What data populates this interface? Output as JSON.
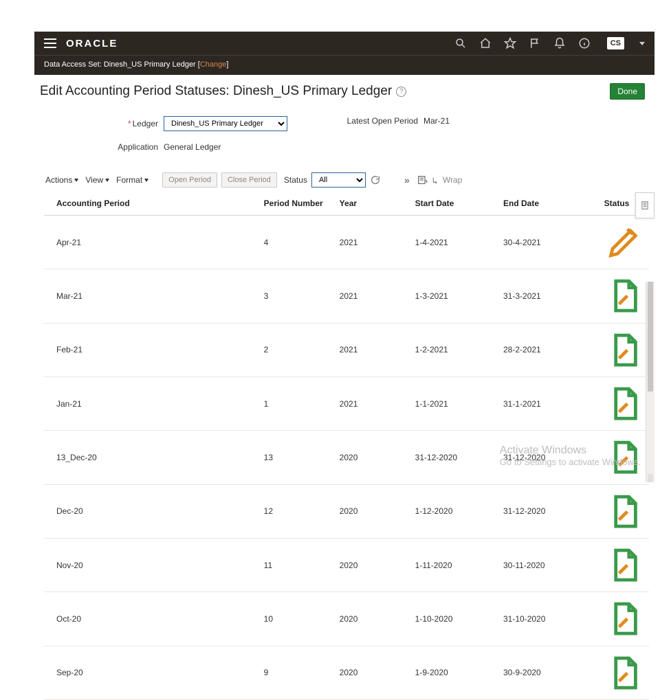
{
  "header": {
    "brand": "ORACLE",
    "user_initials": "CS"
  },
  "subheader": {
    "prefix": "Data Access Set: ",
    "value": "Dinesh_US Primary Ledger",
    "change_label": "Change"
  },
  "page": {
    "title": "Edit Accounting Period Statuses: Dinesh_US Primary Ledger",
    "done_label": "Done"
  },
  "form": {
    "ledger_label": "Ledger",
    "ledger_value": "Dinesh_US Primary Ledger",
    "application_label": "Application",
    "application_value": "General Ledger",
    "latest_open_label": "Latest Open Period",
    "latest_open_value": "Mar-21"
  },
  "toolbar": {
    "actions": "Actions",
    "view": "View",
    "format": "Format",
    "open_period": "Open Period",
    "close_period": "Close Period",
    "status_label": "Status",
    "status_value": "All",
    "wrap": "Wrap"
  },
  "columns": {
    "period": "Accounting Period",
    "number": "Period Number",
    "year": "Year",
    "start": "Start Date",
    "end": "End Date",
    "status": "Status"
  },
  "rows": [
    {
      "period": "Apr-21",
      "number": "4",
      "year": "2021",
      "start": "1-4-2021",
      "end": "30-4-2021",
      "status": "edit"
    },
    {
      "period": "Mar-21",
      "number": "3",
      "year": "2021",
      "start": "1-3-2021",
      "end": "31-3-2021",
      "status": "doc"
    },
    {
      "period": "Feb-21",
      "number": "2",
      "year": "2021",
      "start": "1-2-2021",
      "end": "28-2-2021",
      "status": "doc"
    },
    {
      "period": "Jan-21",
      "number": "1",
      "year": "2021",
      "start": "1-1-2021",
      "end": "31-1-2021",
      "status": "doc"
    },
    {
      "period": "13_Dec-20",
      "number": "13",
      "year": "2020",
      "start": "31-12-2020",
      "end": "31-12-2020",
      "status": "doc"
    },
    {
      "period": "Dec-20",
      "number": "12",
      "year": "2020",
      "start": "1-12-2020",
      "end": "31-12-2020",
      "status": "doc"
    },
    {
      "period": "Nov-20",
      "number": "11",
      "year": "2020",
      "start": "1-11-2020",
      "end": "30-11-2020",
      "status": "doc"
    },
    {
      "period": "Oct-20",
      "number": "10",
      "year": "2020",
      "start": "1-10-2020",
      "end": "31-10-2020",
      "status": "doc"
    },
    {
      "period": "Sep-20",
      "number": "9",
      "year": "2020",
      "start": "1-9-2020",
      "end": "30-9-2020",
      "status": "doc"
    }
  ],
  "watermark": {
    "line1": "Activate Windows",
    "line2": "Go to Settings to activate Windows."
  }
}
